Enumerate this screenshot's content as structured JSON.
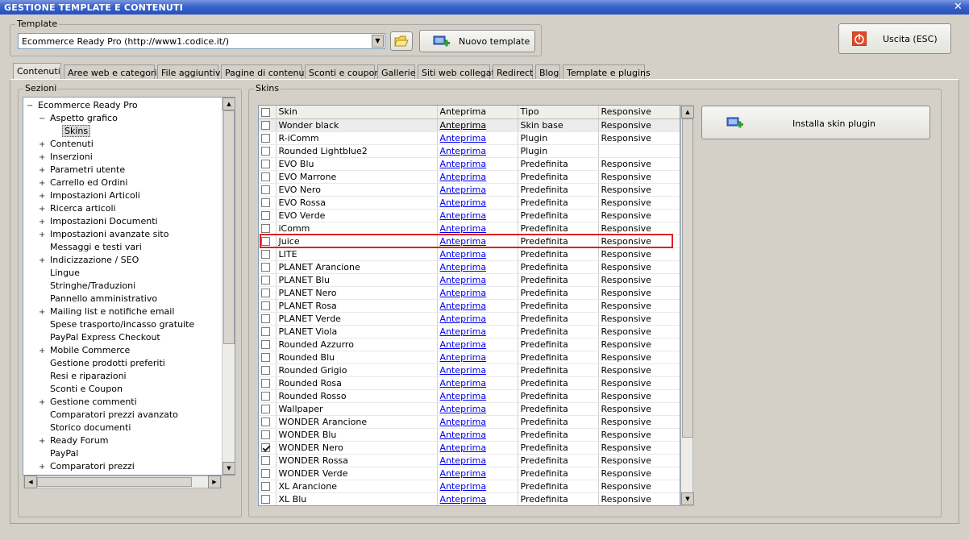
{
  "window": {
    "title": "GESTIONE TEMPLATE E CONTENUTI",
    "close_glyph": "✕"
  },
  "template_group": {
    "label": "Template",
    "selected": "Ecommerce Ready Pro (http://www1.codice.it/)",
    "new_button": "Nuovo template"
  },
  "exit_button": "Uscita (ESC)",
  "tabs": [
    "Contenuti",
    "Aree web e categorie",
    "File aggiuntivi",
    "Pagine di contenuti",
    "Sconti e coupon",
    "Gallerie",
    "Siti web collegati",
    "Redirect",
    "Blog",
    "Template e plugins"
  ],
  "active_tab": "Contenuti",
  "sections": {
    "label": "Sezioni",
    "tree": [
      {
        "label": "Ecommerce Ready Pro",
        "level": 0,
        "exp": "−"
      },
      {
        "label": "Aspetto grafico",
        "level": 1,
        "exp": "−"
      },
      {
        "label": "Skins",
        "level": 2,
        "exp": "",
        "selected": true
      },
      {
        "label": "Contenuti",
        "level": 1,
        "exp": "+"
      },
      {
        "label": "Inserzioni",
        "level": 1,
        "exp": "+"
      },
      {
        "label": "Parametri utente",
        "level": 1,
        "exp": "+"
      },
      {
        "label": "Carrello ed Ordini",
        "level": 1,
        "exp": "+"
      },
      {
        "label": "Impostazioni Articoli",
        "level": 1,
        "exp": "+"
      },
      {
        "label": "Ricerca articoli",
        "level": 1,
        "exp": "+"
      },
      {
        "label": "Impostazioni Documenti",
        "level": 1,
        "exp": "+"
      },
      {
        "label": "Impostazioni avanzate sito",
        "level": 1,
        "exp": "+"
      },
      {
        "label": "Messaggi e testi vari",
        "level": 1,
        "exp": ""
      },
      {
        "label": "Indicizzazione / SEO",
        "level": 1,
        "exp": "+"
      },
      {
        "label": "Lingue",
        "level": 1,
        "exp": ""
      },
      {
        "label": "Stringhe/Traduzioni",
        "level": 1,
        "exp": ""
      },
      {
        "label": "Pannello amministrativo",
        "level": 1,
        "exp": ""
      },
      {
        "label": "Mailing list e notifiche email",
        "level": 1,
        "exp": "+"
      },
      {
        "label": "Spese trasporto/incasso gratuite",
        "level": 1,
        "exp": ""
      },
      {
        "label": "PayPal Express Checkout",
        "level": 1,
        "exp": ""
      },
      {
        "label": "Mobile Commerce",
        "level": 1,
        "exp": "+"
      },
      {
        "label": "Gestione prodotti preferiti",
        "level": 1,
        "exp": ""
      },
      {
        "label": "Resi e riparazioni",
        "level": 1,
        "exp": ""
      },
      {
        "label": "Sconti e Coupon",
        "level": 1,
        "exp": ""
      },
      {
        "label": "Gestione commenti",
        "level": 1,
        "exp": "+"
      },
      {
        "label": "Comparatori prezzi avanzato",
        "level": 1,
        "exp": ""
      },
      {
        "label": "Storico documenti",
        "level": 1,
        "exp": ""
      },
      {
        "label": "Ready Forum",
        "level": 1,
        "exp": "+"
      },
      {
        "label": "PayPal",
        "level": 1,
        "exp": ""
      },
      {
        "label": "Comparatori prezzi",
        "level": 1,
        "exp": "+"
      }
    ]
  },
  "skins": {
    "label": "Skins",
    "columns": [
      "Skin",
      "Anteprima",
      "Tipo",
      "Responsive"
    ],
    "rows": [
      {
        "skin": "Wonder black",
        "preview": "Anteprima",
        "tipo": "Skin base",
        "responsive": "Responsive",
        "checked": false,
        "selected": true
      },
      {
        "skin": "R-iComm",
        "preview": "Anteprima",
        "tipo": "Plugin",
        "responsive": "Responsive",
        "checked": false
      },
      {
        "skin": "Rounded Lightblue2",
        "preview": "Anteprima",
        "tipo": "Plugin",
        "responsive": "",
        "checked": false
      },
      {
        "skin": "EVO Blu",
        "preview": "Anteprima",
        "tipo": "Predefinita",
        "responsive": "Responsive",
        "checked": false
      },
      {
        "skin": "EVO Marrone",
        "preview": "Anteprima",
        "tipo": "Predefinita",
        "responsive": "Responsive",
        "checked": false
      },
      {
        "skin": "EVO Nero",
        "preview": "Anteprima",
        "tipo": "Predefinita",
        "responsive": "Responsive",
        "checked": false
      },
      {
        "skin": "EVO Rossa",
        "preview": "Anteprima",
        "tipo": "Predefinita",
        "responsive": "Responsive",
        "checked": false
      },
      {
        "skin": "EVO Verde",
        "preview": "Anteprima",
        "tipo": "Predefinita",
        "responsive": "Responsive",
        "checked": false
      },
      {
        "skin": "iComm",
        "preview": "Anteprima",
        "tipo": "Predefinita",
        "responsive": "Responsive",
        "checked": false
      },
      {
        "skin": "Juice",
        "preview": "Anteprima",
        "tipo": "Predefinita",
        "responsive": "Responsive",
        "checked": false
      },
      {
        "skin": "LITE",
        "preview": "Anteprima",
        "tipo": "Predefinita",
        "responsive": "Responsive",
        "checked": false
      },
      {
        "skin": "PLANET Arancione",
        "preview": "Anteprima",
        "tipo": "Predefinita",
        "responsive": "Responsive",
        "checked": false
      },
      {
        "skin": "PLANET Blu",
        "preview": "Anteprima",
        "tipo": "Predefinita",
        "responsive": "Responsive",
        "checked": false
      },
      {
        "skin": "PLANET Nero",
        "preview": "Anteprima",
        "tipo": "Predefinita",
        "responsive": "Responsive",
        "checked": false
      },
      {
        "skin": "PLANET Rosa",
        "preview": "Anteprima",
        "tipo": "Predefinita",
        "responsive": "Responsive",
        "checked": false
      },
      {
        "skin": "PLANET Verde",
        "preview": "Anteprima",
        "tipo": "Predefinita",
        "responsive": "Responsive",
        "checked": false
      },
      {
        "skin": "PLANET Viola",
        "preview": "Anteprima",
        "tipo": "Predefinita",
        "responsive": "Responsive",
        "checked": false
      },
      {
        "skin": "Rounded Azzurro",
        "preview": "Anteprima",
        "tipo": "Predefinita",
        "responsive": "Responsive",
        "checked": false
      },
      {
        "skin": "Rounded Blu",
        "preview": "Anteprima",
        "tipo": "Predefinita",
        "responsive": "Responsive",
        "checked": false
      },
      {
        "skin": "Rounded Grigio",
        "preview": "Anteprima",
        "tipo": "Predefinita",
        "responsive": "Responsive",
        "checked": false
      },
      {
        "skin": "Rounded Rosa",
        "preview": "Anteprima",
        "tipo": "Predefinita",
        "responsive": "Responsive",
        "checked": false
      },
      {
        "skin": "Rounded Rosso",
        "preview": "Anteprima",
        "tipo": "Predefinita",
        "responsive": "Responsive",
        "checked": false
      },
      {
        "skin": "Wallpaper",
        "preview": "Anteprima",
        "tipo": "Predefinita",
        "responsive": "Responsive",
        "checked": false
      },
      {
        "skin": "WONDER Arancione",
        "preview": "Anteprima",
        "tipo": "Predefinita",
        "responsive": "Responsive",
        "checked": false
      },
      {
        "skin": "WONDER Blu",
        "preview": "Anteprima",
        "tipo": "Predefinita",
        "responsive": "Responsive",
        "checked": false
      },
      {
        "skin": "WONDER Nero",
        "preview": "Anteprima",
        "tipo": "Predefinita",
        "responsive": "Responsive",
        "checked": true
      },
      {
        "skin": "WONDER Rossa",
        "preview": "Anteprima",
        "tipo": "Predefinita",
        "responsive": "Responsive",
        "checked": false
      },
      {
        "skin": "WONDER Verde",
        "preview": "Anteprima",
        "tipo": "Predefinita",
        "responsive": "Responsive",
        "checked": false
      },
      {
        "skin": "XL Arancione",
        "preview": "Anteprima",
        "tipo": "Predefinita",
        "responsive": "Responsive",
        "checked": false
      },
      {
        "skin": "XL Blu",
        "preview": "Anteprima",
        "tipo": "Predefinita",
        "responsive": "Responsive",
        "checked": false
      }
    ]
  },
  "install_button": "Installa skin plugin",
  "colors": {
    "titlebar": "#2550c0",
    "link": "#0000ee",
    "highlight": "#e02020",
    "window_bg": "#d4d0c8"
  }
}
